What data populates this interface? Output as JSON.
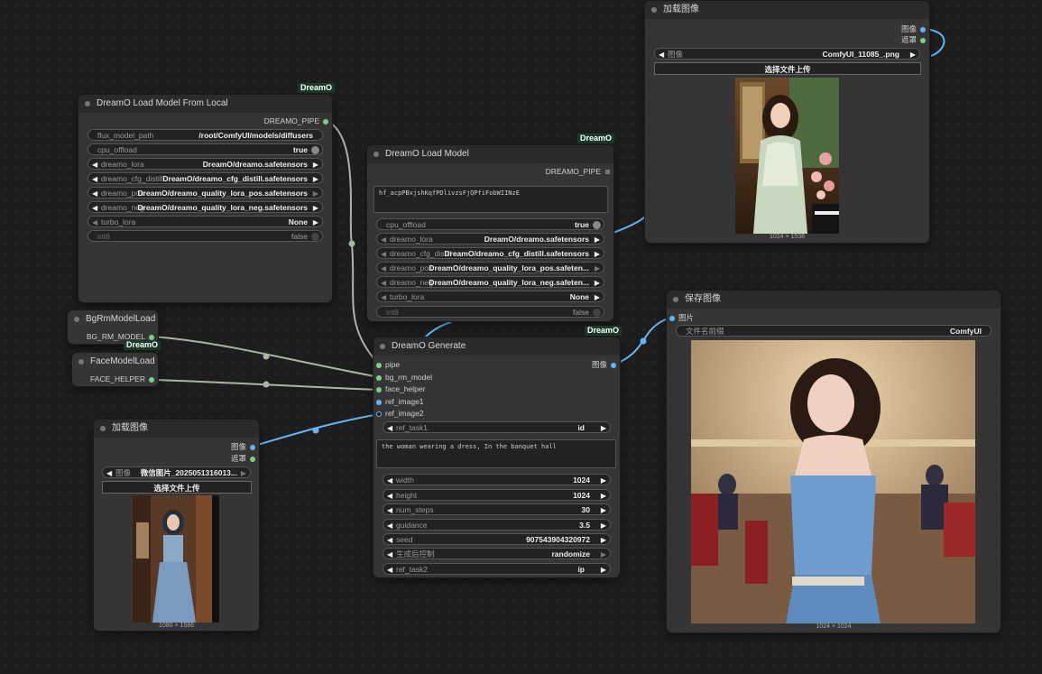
{
  "badge": "DreamO",
  "nodes": {
    "load_local": {
      "title": "DreamO Load Model From Local",
      "output": "DREAMO_PIPE",
      "flux_model_path": {
        "label": "flux_model_path",
        "value": "/root/ComfyUI/models/diffusers"
      },
      "cpu_offload": {
        "label": "cpu_offload",
        "value": "true"
      },
      "dreamo_lora": {
        "label": "dreamo_lora",
        "value": "DreamO/dreamo.safetensors"
      },
      "dreamo_cfg_distill": {
        "label": "dreamo_cfg_distill",
        "value": "DreamO/dreamo_cfg_distill.safetensors"
      },
      "dreamo_pos": {
        "label": "dreamo_pos",
        "value": "DreamO/dreamo_quality_lora_pos.safetensors"
      },
      "dreamo_neg": {
        "label": "dreamo_neg",
        "value": "DreamO/dreamo_quality_lora_neg.safetensors"
      },
      "turbo_lora": {
        "label": "turbo_lora",
        "value": "None"
      },
      "int8": {
        "label": "int8",
        "value": "false"
      }
    },
    "load_model": {
      "title": "DreamO Load Model",
      "output": "DREAMO_PIPE",
      "token": "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",
      "cpu_offload": {
        "label": "cpu_offload",
        "value": "true"
      },
      "dreamo_lora": {
        "label": "dreamo_lora",
        "value": "DreamO/dreamo.safetensors"
      },
      "dreamo_cfg_distill": {
        "label": "dreamo_cfg_distill",
        "value": "DreamO/dreamo_cfg_distill.safetensors"
      },
      "dreamo_pos": {
        "label": "dreamo_pos",
        "value": "DreamO/dreamo_quality_lora_pos.safeten..."
      },
      "dreamo_neg": {
        "label": "dreamo_neg",
        "value": "DreamO/dreamo_quality_lora_neg.safeten..."
      },
      "turbo_lora": {
        "label": "turbo_lora",
        "value": "None"
      },
      "int8": {
        "label": "int8",
        "value": "false"
      }
    },
    "bgrm": {
      "title": "BgRmModelLoad",
      "output": "BG_RM_MODEL"
    },
    "face": {
      "title": "FaceModelLoad",
      "output": "FACE_HELPER"
    },
    "load_image_top": {
      "title": "加载图像",
      "out_image": "图像",
      "out_mask": "遮罩",
      "image": {
        "label": "图像",
        "value": "ComfyUI_11085_.png"
      },
      "upload": "选择文件上传",
      "dims": "1024 × 1536"
    },
    "load_image_bottom": {
      "title": "加载图像",
      "out_image": "图像",
      "out_mask": "遮罩",
      "image": {
        "label": "图像",
        "value": "微信图片_2025051316013..."
      },
      "upload": "选择文件上传",
      "dims": "1080 × 1586"
    },
    "generate": {
      "title": "DreamO Generate",
      "inputs": [
        "pipe",
        "bg_rm_model",
        "face_helper",
        "ref_image1",
        "ref_image2"
      ],
      "output": "图像",
      "ref_task1": {
        "label": "ref_task1",
        "value": "id"
      },
      "prompt": "the woman wearing a dress, In the banquet hall",
      "width": {
        "label": "width",
        "value": "1024"
      },
      "height": {
        "label": "height",
        "value": "1024"
      },
      "num_steps": {
        "label": "num_steps",
        "value": "30"
      },
      "guidance": {
        "label": "guidance",
        "value": "3.5"
      },
      "seed": {
        "label": "seed",
        "value": "907543904320972"
      },
      "control": {
        "label": "生成后控制",
        "value": "randomize"
      },
      "ref_task2": {
        "label": "ref_task2",
        "value": "ip"
      }
    },
    "save": {
      "title": "保存图像",
      "input": "图片",
      "prefix": {
        "label": "文件名前缀",
        "value": "ComfyUI"
      },
      "dims": "1024 × 1024"
    }
  },
  "colors": {
    "canvas": "#1d1d1d",
    "node_body": "#353535",
    "node_title": "#2b2b2b",
    "link_image": "#64b5f6",
    "link_other": "#a9b6a4",
    "badge_bg": "#1a3a2a"
  }
}
